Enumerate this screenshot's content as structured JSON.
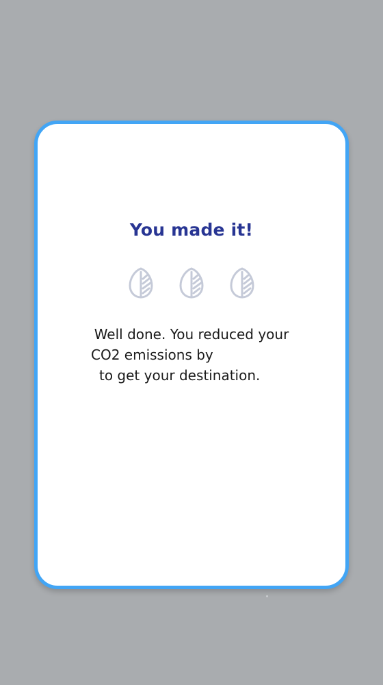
{
  "card": {
    "title": "You made it!",
    "leaf_icons": [
      "leaf-icon",
      "leaf-icon",
      "leaf-icon"
    ],
    "message_line1": "Well done. You reduced your",
    "message_line2": "CO2 emissions by",
    "message_line3": "to get your destination."
  },
  "colors": {
    "background": "#a9acaf",
    "card_border": "#42a5f5",
    "title": "#283593",
    "leaf_icon": "#c5cad8"
  }
}
